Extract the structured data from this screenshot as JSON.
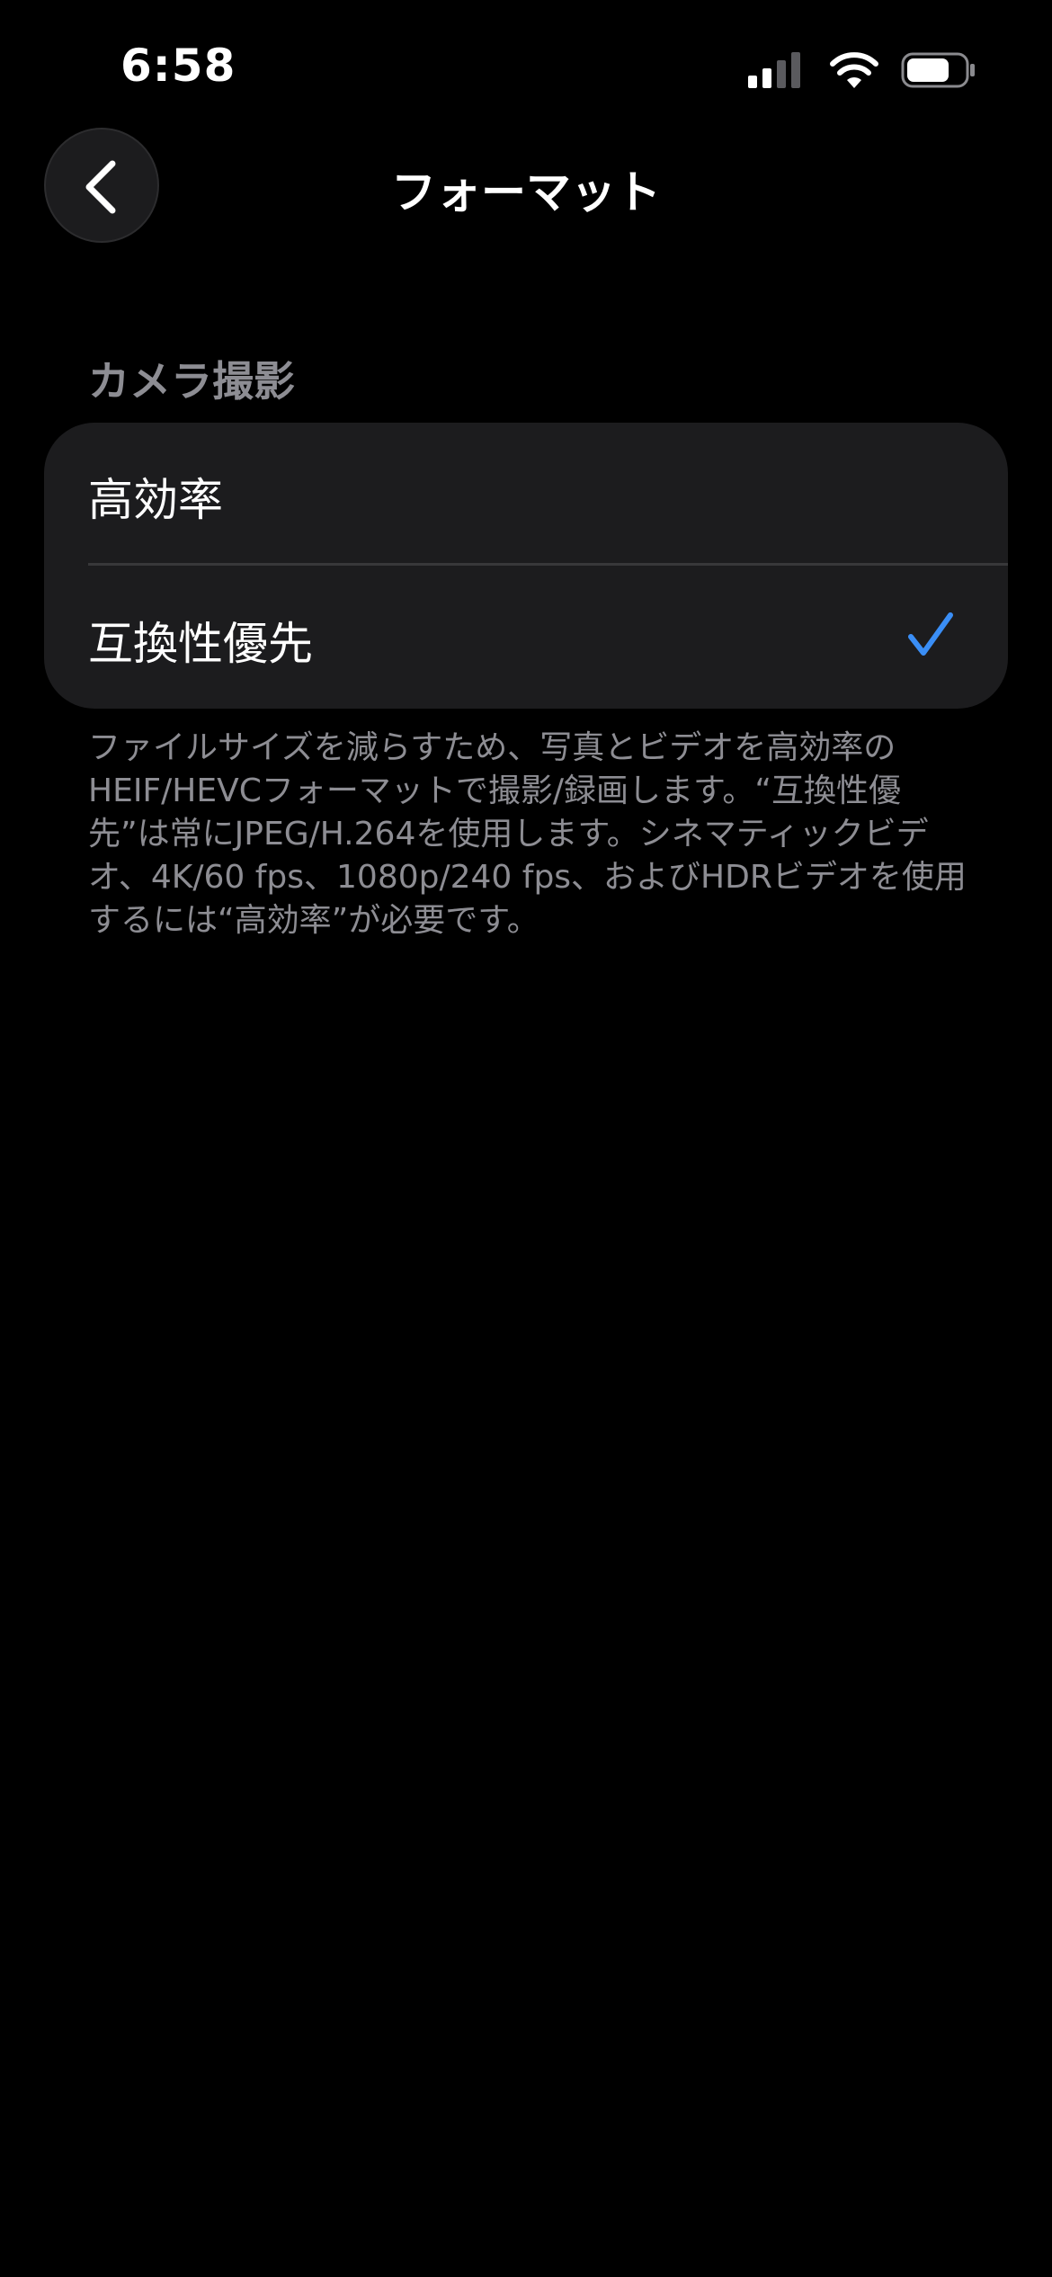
{
  "status_bar": {
    "time": "6:58"
  },
  "nav": {
    "title": "フォーマット",
    "back_icon": "chevron-left-icon"
  },
  "section": {
    "header": "カメラ撮影",
    "options": [
      {
        "label": "高効率",
        "selected": false
      },
      {
        "label": "互換性優先",
        "selected": true
      }
    ]
  },
  "footer": {
    "text": "ファイルサイズを減らすため、写真とビデオを高効率のHEIF/HEVCフォーマットで撮影/録画します。“互換性優先”は常にJPEG/H.264を使用します。シネマティックビデオ、4K/60 fps、1080p/240 fps、およびHDRビデオを使用するには“高効率”が必要です。"
  },
  "colors": {
    "background": "#000000",
    "group_background": "#1c1c1e",
    "accent": "#3a8ef6",
    "secondary_text": "#8d8d93"
  }
}
